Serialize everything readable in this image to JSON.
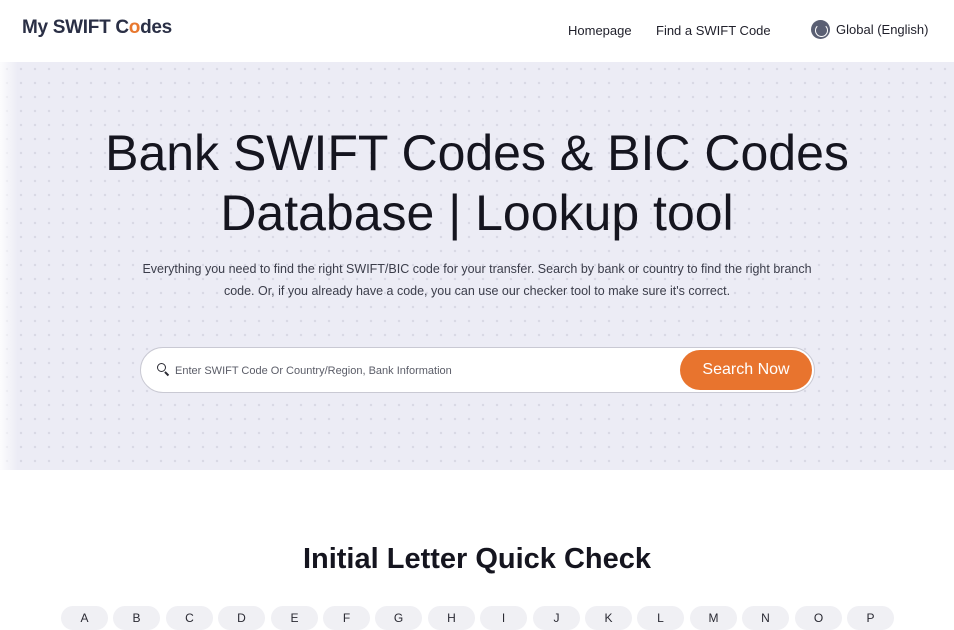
{
  "header": {
    "logo_part1": "My SWIFT C",
    "logo_o": "o",
    "logo_part2": "des",
    "nav": [
      "Homepage",
      "Find a SWIFT Code"
    ],
    "language": "Global (English)",
    "language_icon": "globe-icon"
  },
  "hero": {
    "title_line1": "Bank SWIFT Codes & BIC Codes",
    "title_line2": "Database | Lookup tool",
    "description_line1": "Everything you need to find the right SWIFT/BIC code for your transfer. Search by bank or country to find the right branch",
    "description_line2": "code. Or, if you already have a code, you can use our checker tool to make sure it's correct.",
    "search": {
      "icon": "search-icon",
      "placeholder": "Enter SWIFT Code Or Country/Region, Bank Information",
      "value": "",
      "button": "Search Now"
    }
  },
  "quick_check": {
    "title": "Initial Letter Quick Check",
    "letters": [
      "A",
      "B",
      "C",
      "D",
      "E",
      "F",
      "G",
      "H",
      "I",
      "J",
      "K",
      "L",
      "M",
      "N",
      "O",
      "P"
    ]
  },
  "colors": {
    "accent": "#e8742e",
    "hero_bg": "#ececf5",
    "logo_text": "#2a2f45",
    "text": "#15151f"
  }
}
